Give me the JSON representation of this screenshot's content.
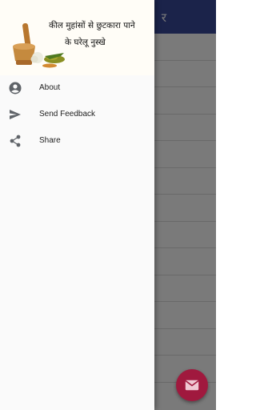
{
  "app": {
    "title": "र"
  },
  "drawer": {
    "header": {
      "line1": "कील मुहांसों से छुटकारा पाने",
      "line2": "के घरेलू नुस्खे"
    },
    "menu": [
      {
        "label": "About",
        "icon": "account-circle-icon"
      },
      {
        "label": "Send Feedback",
        "icon": "send-icon"
      },
      {
        "label": "Share",
        "icon": "share-icon"
      }
    ]
  },
  "fab": {
    "icon": "email-icon"
  },
  "colors": {
    "appbar": "#3a4a9b",
    "fab": "#a0193e",
    "drawer_bg": "#fafafa"
  }
}
